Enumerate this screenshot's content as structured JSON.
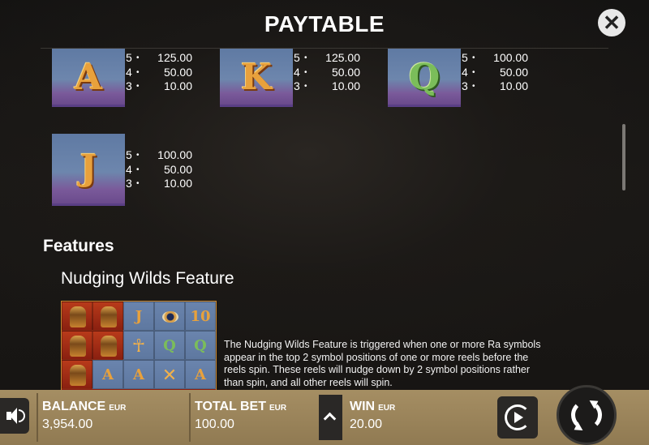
{
  "header": {
    "title": "PAYTABLE",
    "close_icon": "close-icon"
  },
  "symbols": [
    {
      "letter": "A",
      "payouts": [
        {
          "count": "5",
          "value": "125.00"
        },
        {
          "count": "4",
          "value": "50.00"
        },
        {
          "count": "3",
          "value": "10.00"
        }
      ]
    },
    {
      "letter": "K",
      "payouts": [
        {
          "count": "5",
          "value": "125.00"
        },
        {
          "count": "4",
          "value": "50.00"
        },
        {
          "count": "3",
          "value": "10.00"
        }
      ]
    },
    {
      "letter": "Q",
      "payouts": [
        {
          "count": "5",
          "value": "100.00"
        },
        {
          "count": "4",
          "value": "50.00"
        },
        {
          "count": "3",
          "value": "10.00"
        }
      ]
    },
    {
      "letter": "J",
      "payouts": [
        {
          "count": "5",
          "value": "100.00"
        },
        {
          "count": "4",
          "value": "50.00"
        },
        {
          "count": "3",
          "value": "10.00"
        }
      ]
    }
  ],
  "pay_dot": "•",
  "features": {
    "heading": "Features",
    "nudging": {
      "title": "Nudging Wilds Feature",
      "description": "The Nudging Wilds Feature is triggered when one or more Ra symbols appear in the top 2 symbol positions of one or more reels before the reels spin. These reels will nudge down by 2 symbol positions rather than spin, and all other reels will spin.",
      "reel_labels": {
        "j": "J",
        "ten": "10",
        "q": "Q",
        "a": "A"
      }
    }
  },
  "bottom_bar": {
    "balance": {
      "label": "BALANCE",
      "currency": "EUR",
      "value": "3,954.00"
    },
    "total_bet": {
      "label": "TOTAL BET",
      "currency": "EUR",
      "value": "100.00"
    },
    "win": {
      "label": "WIN",
      "currency": "EUR",
      "value": "20.00"
    }
  }
}
